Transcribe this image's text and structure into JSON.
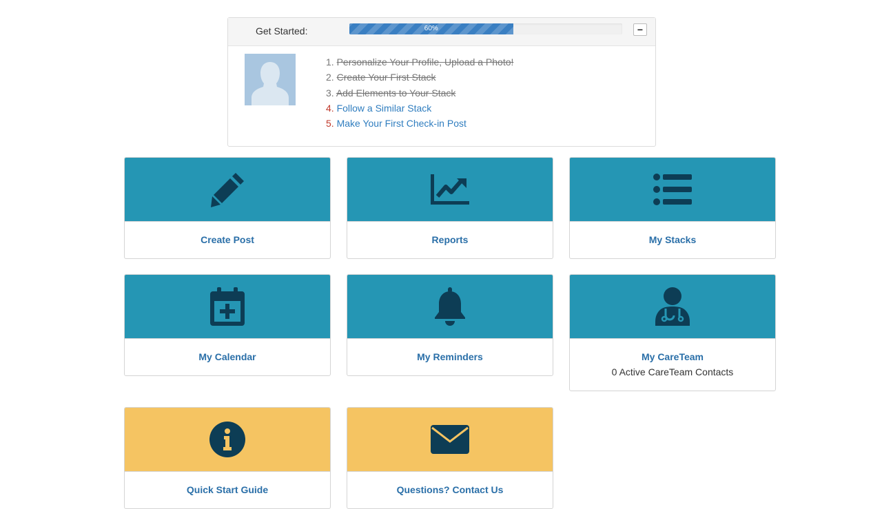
{
  "get_started": {
    "title": "Get Started:",
    "progress_label": "60%",
    "progress_fraction": 0.6,
    "collapse_label": "−",
    "steps": [
      {
        "number": "1.",
        "text": "Personalize Your Profile, Upload a Photo!",
        "done": true
      },
      {
        "number": "2.",
        "text": "Create Your First Stack",
        "done": true
      },
      {
        "number": "3.",
        "text": "Add Elements to Your Stack",
        "done": true
      },
      {
        "number": "4.",
        "text": "Follow a Similar Stack",
        "done": false
      },
      {
        "number": "5.",
        "text": "Make Your First Check-in Post",
        "done": false
      }
    ]
  },
  "tiles": {
    "create_post": {
      "label": "Create Post",
      "icon": "pencil-icon"
    },
    "reports": {
      "label": "Reports",
      "icon": "chart-line-icon"
    },
    "my_stacks": {
      "label": "My Stacks",
      "icon": "list-icon"
    },
    "my_calendar": {
      "label": "My Calendar",
      "icon": "calendar-plus-icon"
    },
    "my_reminders": {
      "label": "My Reminders",
      "icon": "bell-icon"
    },
    "my_careteam": {
      "label": "My CareTeam",
      "subtitle": "0 Active CareTeam Contacts",
      "icon": "doctor-icon"
    },
    "quick_start": {
      "label": "Quick Start Guide",
      "icon": "info-icon"
    },
    "contact_us": {
      "label": "Questions? Contact Us",
      "icon": "envelope-icon"
    }
  },
  "colors": {
    "tile_teal": "#2596b4",
    "tile_gold": "#f5c462",
    "icon_dark": "#0d3d55",
    "link_blue": "#2a6fa8",
    "progress_blue": "#3a7fc2"
  }
}
